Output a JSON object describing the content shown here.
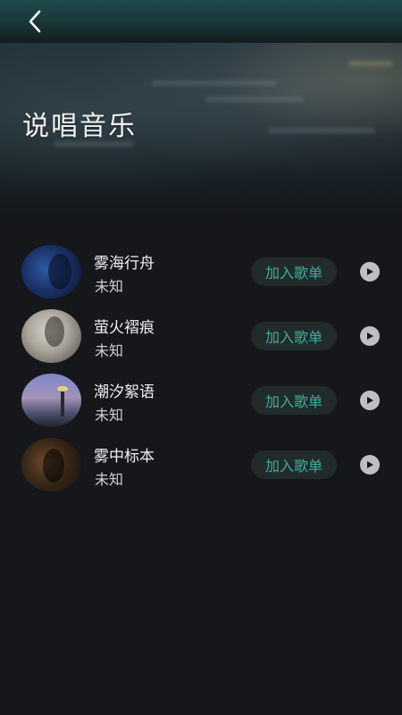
{
  "header": {
    "back_icon": "chevron-left-icon"
  },
  "page": {
    "title": "说唱音乐"
  },
  "songs": [
    {
      "title": "雾海行舟",
      "artist": "未知",
      "action_label": "加入歌单"
    },
    {
      "title": "萤火褶痕",
      "artist": "未知",
      "action_label": "加入歌单"
    },
    {
      "title": "潮汐絮语",
      "artist": "未知",
      "action_label": "加入歌单"
    },
    {
      "title": "雾中标本",
      "artist": "未知",
      "action_label": "加入歌单"
    }
  ],
  "colors": {
    "accent": "#3fae9e",
    "background": "#15171a",
    "button_bg": "#222a2a",
    "header": "#1f4a4c"
  }
}
